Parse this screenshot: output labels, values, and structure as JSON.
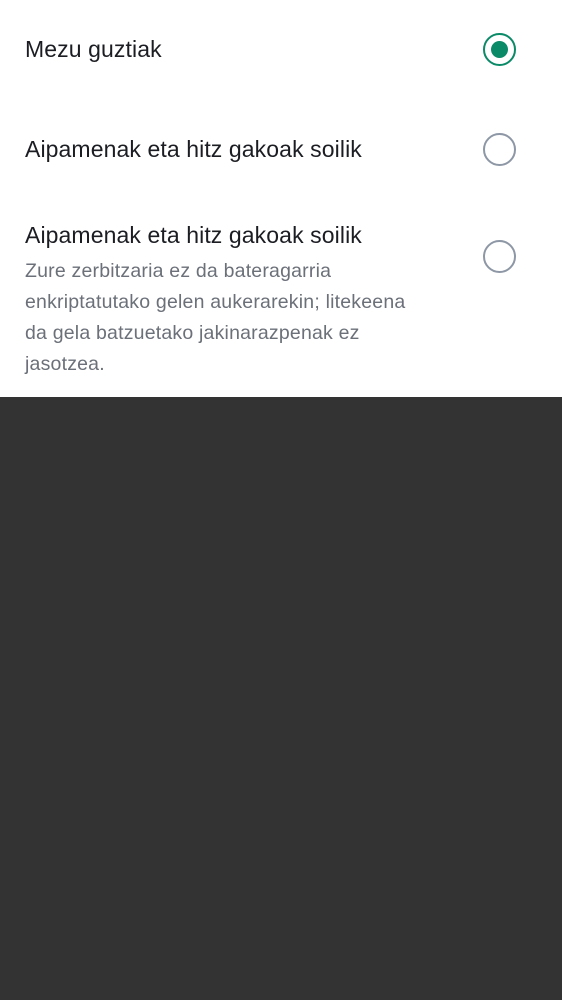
{
  "options": [
    {
      "label": "Mezu guztiak",
      "selected": true
    },
    {
      "label": "Aipamenak eta hitz gakoak soilik",
      "selected": false
    },
    {
      "label": "Aipamenak eta hitz gakoak soilik",
      "description": "Zure zerbitzaria ez da bateragarria enkriptatutako gelen aukerarekin; litekeena da gela batzuetako jakinarazpenak ez jasotzea.",
      "selected": false
    }
  ],
  "colors": {
    "accent": "#0b8a68",
    "radio_unselected": "#8d97a5",
    "primary_text": "#1b1d22",
    "secondary_text": "#6b7079",
    "sheet_background": "#ffffff",
    "backdrop": "#333333"
  }
}
